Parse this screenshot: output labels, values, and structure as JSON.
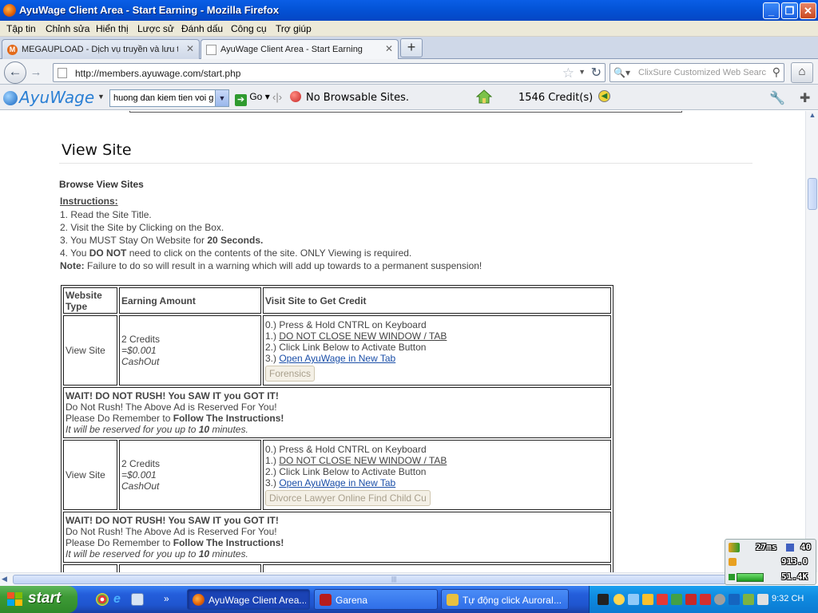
{
  "window": {
    "title": "AyuWage Client Area - Start Earning - Mozilla Firefox",
    "controls": [
      "minimize",
      "maximize",
      "close"
    ]
  },
  "menubar": {
    "items": [
      "Tập tin",
      "Chỉnh sửa",
      "Hiển thị",
      "Lược sử",
      "Đánh dấu",
      "Công cụ",
      "Trợ giúp"
    ]
  },
  "tabs": [
    {
      "label": "MEGAUPLOAD - Dịch vụ truyền và lưu tr...",
      "icon": "megaupload-icon",
      "active": false
    },
    {
      "label": "AyuWage Client Area - Start Earning",
      "icon": "page-icon",
      "active": true
    }
  ],
  "navbar": {
    "url": "http://members.ayuwage.com/start.php",
    "search_placeholder": "ClixSure Customized Web Search"
  },
  "ayubar": {
    "logo": "AyuWage",
    "search_value": "huong dan kiem tien voi go",
    "go_label": "Go",
    "status": "No Browsable Sites.",
    "credits": "1546 Credit(s)"
  },
  "page": {
    "title": "View Site",
    "browse_heading": "Browse View Sites",
    "instructions_heading": "Instructions:",
    "instructions": [
      {
        "pre": "1. Read the Site Title.",
        "bold": "",
        "post": ""
      },
      {
        "pre": "2. Visit the Site by Clicking on the Box.",
        "bold": "",
        "post": ""
      },
      {
        "pre": "3. You MUST Stay On Website for ",
        "bold": "20 Seconds.",
        "post": ""
      },
      {
        "pre": "4. You ",
        "bold": "DO NOT",
        "post": " need to click on the contents of the site. ONLY Viewing is required."
      }
    ],
    "note_label": "Note:",
    "note_text": " Failure to do so will result in a warning which will add up towards to a permanent suspension!"
  },
  "table": {
    "headers": [
      "Website Type",
      "Earning Amount",
      "Visit Site to Get Credit"
    ],
    "rows": [
      {
        "type": "View Site",
        "amount": "2 Credits",
        "usd": "=$0.001",
        "cashout": "CashOut",
        "step0": "0.) Press & Hold CNTRL on Keyboard",
        "step1_prefix": "1.) ",
        "step1": "DO NOT CLOSE NEW WINDOW / TAB",
        "step2": "2.) Click Link Below to Activate Button",
        "step3_prefix": "3.) ",
        "step3": "Open AyuWage in New Tab",
        "button": "Forensics",
        "wait_title": "WAIT! DO NOT RUSH! You SAW IT you GOT IT!",
        "wait_line1": "Do Not Rush! The Above Ad is Reserved For You!",
        "wait_line2_pre": "Please Do Remember to ",
        "wait_line2_bold": "Follow The Instructions!",
        "wait_line3_pre": "It will be reserved for you up to ",
        "wait_line3_bold": "10",
        "wait_line3_post": " minutes."
      },
      {
        "type": "View Site",
        "amount": "2 Credits",
        "usd": "=$0.001",
        "cashout": "CashOut",
        "step0": "0.) Press & Hold CNTRL on Keyboard",
        "step1_prefix": "1.) ",
        "step1": "DO NOT CLOSE NEW WINDOW / TAB",
        "step2": "2.) Click Link Below to Activate Button",
        "step3_prefix": "3.) ",
        "step3": "Open AyuWage in New Tab",
        "button": "Divorce Lawyer Online Find Child Cu",
        "wait_title": "WAIT! DO NOT RUSH! You SAW IT you GOT IT!",
        "wait_line1": "Do Not Rush! The Above Ad is Reserved For You!",
        "wait_line2_pre": "Please Do Remember to ",
        "wait_line2_bold": "Follow The Instructions!",
        "wait_line3_pre": "It will be reserved for you up to ",
        "wait_line3_bold": "10",
        "wait_line3_post": " minutes."
      }
    ]
  },
  "meter": {
    "ping": "27ms",
    "count": "40",
    "value1": "913.0",
    "value2": "51.4K"
  },
  "taskbar": {
    "start": "start",
    "buttons": [
      {
        "label": "AyuWage Client Area...",
        "active": true
      },
      {
        "label": "Garena",
        "active": false
      },
      {
        "label": "Tự động click AuroraI...",
        "active": false
      }
    ],
    "clock": "9:32 CH"
  },
  "colors": {
    "titlebar": "#0454d8",
    "link": "#1b4fa8",
    "taskbar": "#245edb",
    "start": "#3d9a36",
    "tray": "#0f8be0"
  }
}
